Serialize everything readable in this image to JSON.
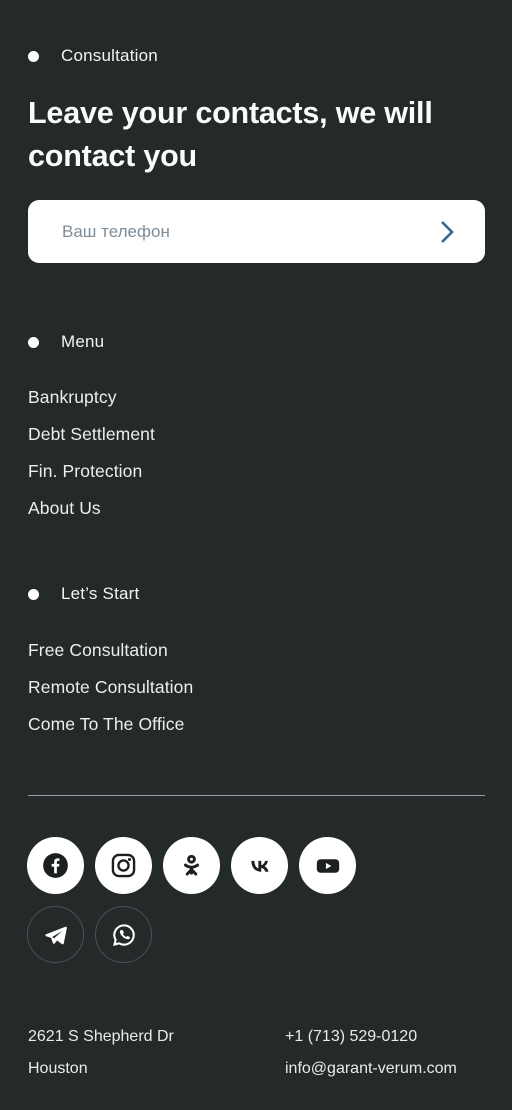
{
  "theme": {
    "background": "#24292a",
    "text": "#f1f3f3",
    "field_background": "#ffffff",
    "placeholder": "#7d8d99",
    "accent_arrow": "#36688c",
    "divider": "#9aa0a2"
  },
  "consultation": {
    "eyebrow": "Consultation",
    "headline": "Leave your contacts, we will contact you",
    "form": {
      "placeholder": "Ваш телефон",
      "value": "",
      "submit_icon": "chevron-right-icon"
    }
  },
  "menu": {
    "eyebrow": "Menu",
    "items": [
      {
        "label": "Bankruptcy"
      },
      {
        "label": "Debt Settlement"
      },
      {
        "label": "Fin. Protection"
      },
      {
        "label": "About Us"
      }
    ]
  },
  "lets_start": {
    "eyebrow": "Let’s Start",
    "items": [
      {
        "label": "Free Consultation"
      },
      {
        "label": "Remote Consultation"
      },
      {
        "label": "Come To The Office"
      }
    ]
  },
  "socials": {
    "primary": [
      {
        "name": "facebook",
        "icon": "facebook-icon",
        "style": "filled"
      },
      {
        "name": "instagram",
        "icon": "instagram-icon",
        "style": "filled"
      },
      {
        "name": "odnoklassniki",
        "icon": "odnoklassniki-icon",
        "style": "filled"
      },
      {
        "name": "vk",
        "icon": "vk-icon",
        "style": "filled"
      },
      {
        "name": "youtube",
        "icon": "youtube-icon",
        "style": "filled"
      }
    ],
    "secondary": [
      {
        "name": "telegram",
        "icon": "telegram-icon",
        "style": "outline"
      },
      {
        "name": "whatsapp",
        "icon": "whatsapp-icon",
        "style": "outline"
      }
    ]
  },
  "contacts": {
    "address_line1": "2621 S Shepherd Dr",
    "address_line2": "Houston",
    "phone": "+1 (713) 529-0120",
    "email": "info@garant-verum.com"
  }
}
